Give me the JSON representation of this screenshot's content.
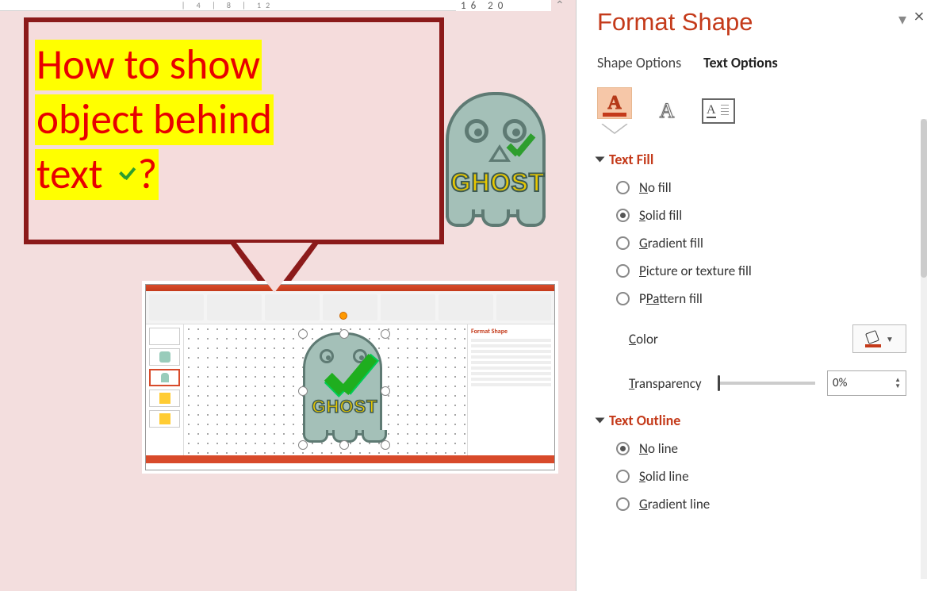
{
  "ruler": {
    "marks": "| 4 | 8 | 12",
    "zoom": "16  20"
  },
  "callout": {
    "line1": "How to show",
    "line2": "object behind",
    "line3a": "text ",
    "line3b": "?"
  },
  "ghost": {
    "label": "GHOST"
  },
  "thumb": {
    "panel_title": "Format Shape",
    "ghost_label": "GHOST"
  },
  "panel": {
    "title": "Format Shape",
    "tab_shape": "Shape Options",
    "tab_text": "Text Options",
    "section_fill": "Text Fill",
    "fill_options": {
      "none": "o fill",
      "none_u": "N",
      "solid": "olid fill",
      "solid_u": "S",
      "gradient": "radient fill",
      "gradient_u": "G",
      "picture": "icture or texture fill",
      "picture_u": "P",
      "pattern": "ttern fill",
      "pattern_u": "Pa"
    },
    "color_label_u": "C",
    "color_label": "olor",
    "transparency_u": "T",
    "transparency_label": "ransparency",
    "transparency_value": "0%",
    "section_outline": "Text Outline",
    "outline_options": {
      "none": "o line",
      "none_u": "N",
      "solid": "olid line",
      "solid_u": "S",
      "gradient": "radient line",
      "gradient_u": "G"
    }
  }
}
